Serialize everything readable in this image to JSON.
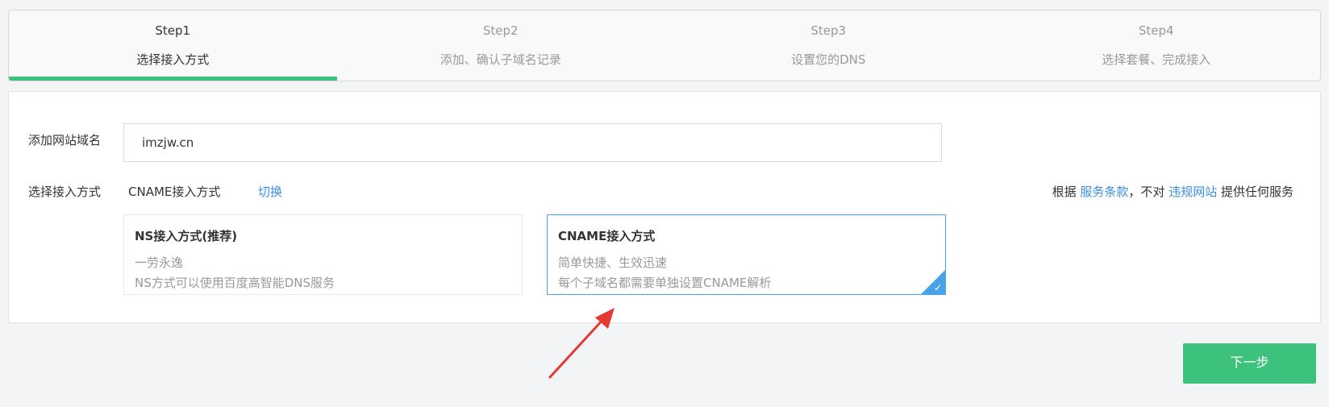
{
  "steps": [
    {
      "num": "Step1",
      "label": "选择接入方式",
      "active": true
    },
    {
      "num": "Step2",
      "label": "添加、确认子域名记录",
      "active": false
    },
    {
      "num": "Step3",
      "label": "设置您的DNS",
      "active": false
    },
    {
      "num": "Step4",
      "label": "选择套餐、完成接入",
      "active": false
    }
  ],
  "form": {
    "domain_label": "添加网站域名",
    "domain_value": "imzjw.cn",
    "method_label": "选择接入方式",
    "method_value": "CNAME接入方式",
    "switch_label": "切换"
  },
  "terms": {
    "prefix": "根据",
    "service_terms": "服务条款",
    "middle": "，不对",
    "illegal_sites": "违规网站",
    "suffix": "提供任何服务"
  },
  "options": [
    {
      "title": "NS接入方式(推荐)",
      "desc1": "一劳永逸",
      "desc2": "NS方式可以使用百度高智能DNS服务",
      "selected": false
    },
    {
      "title": "CNAME接入方式",
      "desc1": "简单快捷、生效迅速",
      "desc2": "每个子域名都需要单独设置CNAME解析",
      "selected": true
    }
  ],
  "next_button": "下一步",
  "colors": {
    "accent_green": "#3cc27c",
    "link_blue": "#3a8ee6",
    "selected_border": "#4aa3e8",
    "annotation_arrow": "#e53935"
  }
}
